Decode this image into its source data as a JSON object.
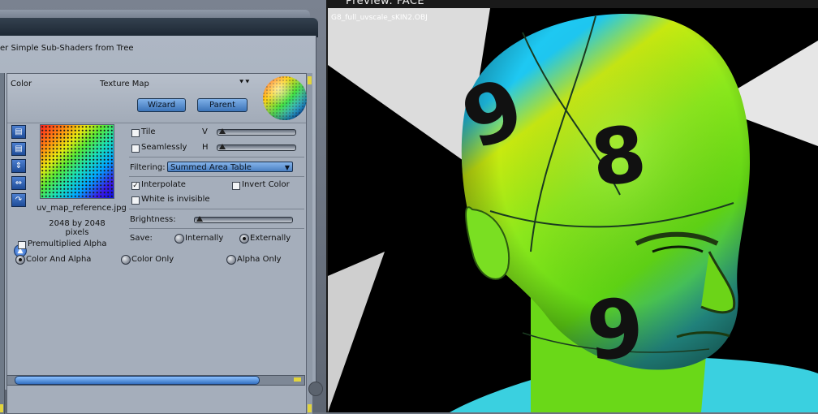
{
  "shader_panel": {
    "subshader_label": "er Simple Sub-Shaders from Tree",
    "node": {
      "color_label": "Color",
      "title": "Texture Map",
      "wizard_label": "Wizard",
      "parent_label": "Parent",
      "filename": "uv_map_reference.jpg",
      "dimensions": "2048 by 2048 pixels",
      "tile_label": "Tile",
      "v_label": "V",
      "seamlessly_label": "Seamlessly",
      "h_label": "H",
      "filtering_label": "Filtering:",
      "filtering_value": "Summed Area Table",
      "interpolate_label": "Interpolate",
      "interpolate_checked": true,
      "invert_color_label": "Invert Color",
      "white_invisible_label": "White is invisible",
      "brightness_label": "Brightness:",
      "save_label": "Save:",
      "save_options": [
        "Internally",
        "Externally"
      ],
      "save_selected": "Externally",
      "premultiplied_label": "Premultiplied Alpha",
      "alpha_modes": [
        "Color And Alpha",
        "Color Only",
        "Alpha Only"
      ],
      "alpha_mode_selected": "Color And Alpha"
    },
    "icons": [
      "folder-open-icon",
      "folder-open-icon",
      "vertical-arrows-icon",
      "horizontal-arrows-icon",
      "rotate-icon"
    ]
  },
  "preview": {
    "title": "Preview: FACE",
    "object_name": "G8_full_uvscale_sKIN2.OBJ",
    "visible_digits": [
      "9",
      "8",
      "9"
    ]
  },
  "colors": {
    "button_blue": "#4a80c2",
    "panel_gray": "#a5aebb",
    "head_green": "#8be81c",
    "head_cyan": "#1ec8f2"
  }
}
